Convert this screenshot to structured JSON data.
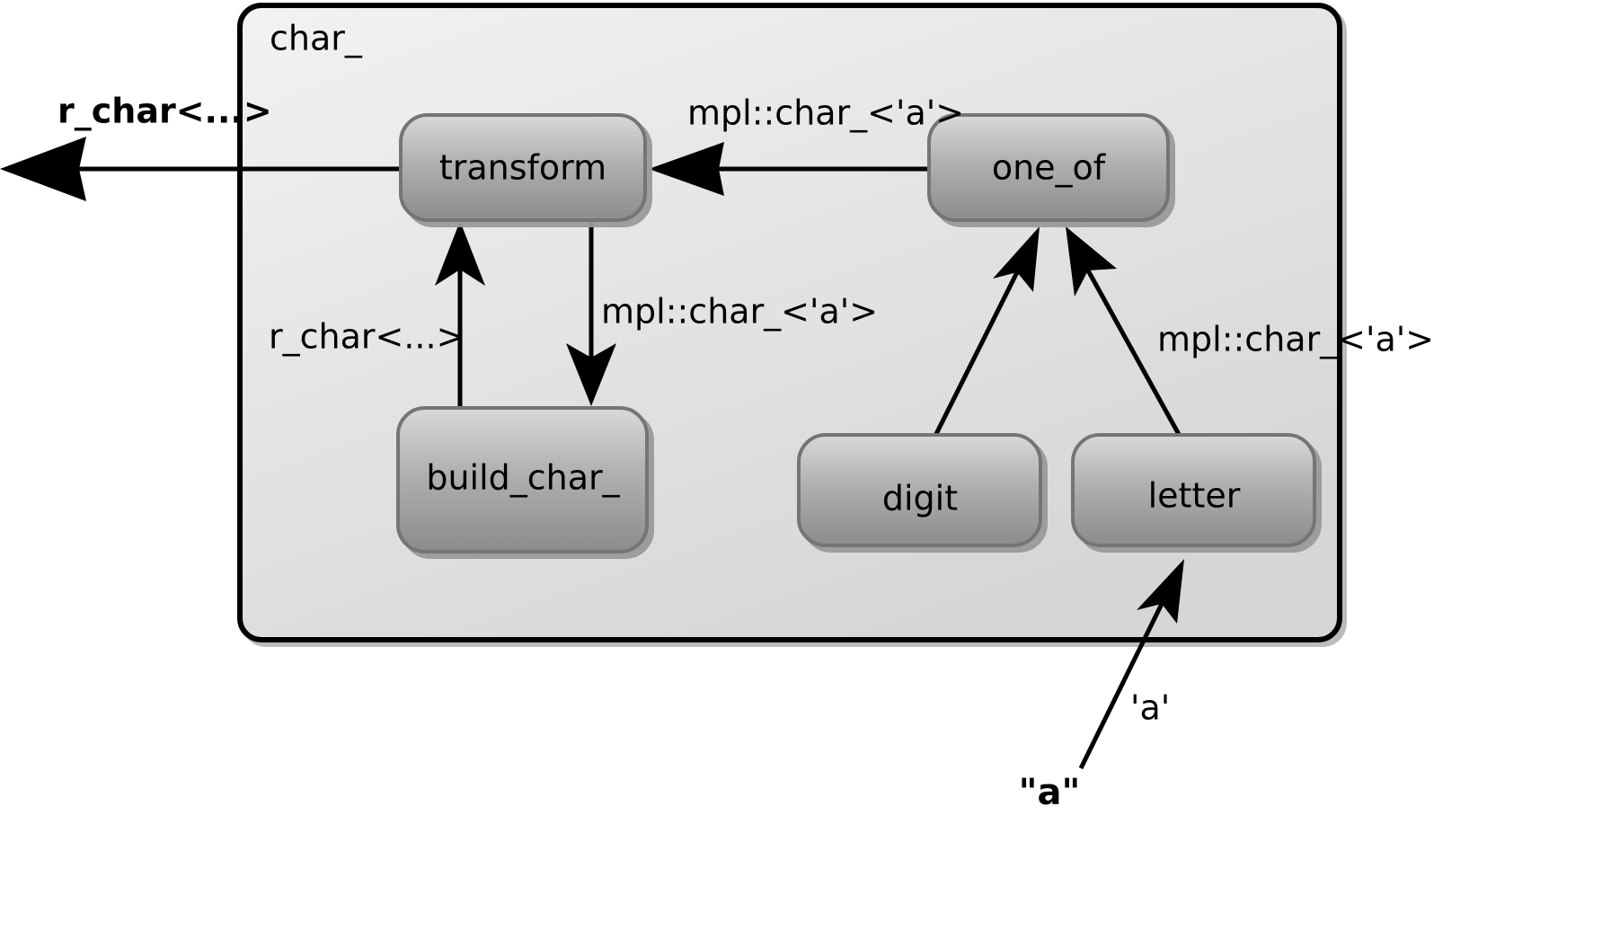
{
  "diagram": {
    "title": "char_ parser metafunction graph",
    "background_color": "#ffffff",
    "cluster": {
      "label": "char_",
      "fill_top": "#f0f0f0",
      "fill_bottom": "#d8d8d8",
      "border_color": "#000000"
    },
    "node_style": {
      "fill_top": "#cfcfcf",
      "fill_bottom": "#8f8f8f",
      "border_color": "#6e6e6e",
      "text_color": "#000000"
    },
    "nodes": [
      {
        "id": "transform",
        "label": "transform",
        "inside_cluster": true
      },
      {
        "id": "one_of",
        "label": "one_of",
        "inside_cluster": true
      },
      {
        "id": "build_char_",
        "label": "build_char_",
        "inside_cluster": true
      },
      {
        "id": "digit",
        "label": "digit",
        "inside_cluster": true
      },
      {
        "id": "letter",
        "label": "letter",
        "inside_cluster": true
      }
    ],
    "external_nodes": [
      {
        "id": "a_string",
        "label": "\"a\""
      }
    ],
    "edges": [
      {
        "id": "e-one_of-transform",
        "from": "one_of",
        "to": "transform",
        "label": "mpl::char_<'a'>",
        "bold": false
      },
      {
        "id": "e-transform-out",
        "from": "transform",
        "to": "output",
        "label": "r_char<...>",
        "bold": true
      },
      {
        "id": "e-build-transform",
        "from": "build_char_",
        "to": "transform",
        "label": "r_char<...>",
        "bold": false
      },
      {
        "id": "e-transform-build",
        "from": "transform",
        "to": "build_char_",
        "label": "mpl::char_<'a'>",
        "bold": false
      },
      {
        "id": "e-digit-one_of",
        "from": "digit",
        "to": "one_of",
        "label": "",
        "bold": false
      },
      {
        "id": "e-letter-one_of",
        "from": "letter",
        "to": "one_of",
        "label": "mpl::char_<'a'>",
        "bold": false
      },
      {
        "id": "e-a-letter",
        "from": "a_string",
        "to": "letter",
        "label": "'a'",
        "bold": false
      }
    ]
  }
}
